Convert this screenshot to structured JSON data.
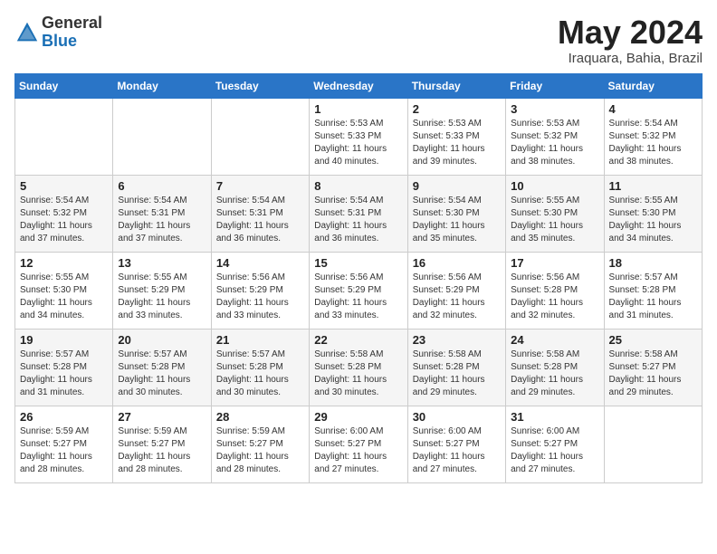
{
  "logo": {
    "general": "General",
    "blue": "Blue"
  },
  "title": "May 2024",
  "location": "Iraquara, Bahia, Brazil",
  "days_of_week": [
    "Sunday",
    "Monday",
    "Tuesday",
    "Wednesday",
    "Thursday",
    "Friday",
    "Saturday"
  ],
  "weeks": [
    [
      {
        "day": "",
        "info": ""
      },
      {
        "day": "",
        "info": ""
      },
      {
        "day": "",
        "info": ""
      },
      {
        "day": "1",
        "info": "Sunrise: 5:53 AM\nSunset: 5:33 PM\nDaylight: 11 hours\nand 40 minutes."
      },
      {
        "day": "2",
        "info": "Sunrise: 5:53 AM\nSunset: 5:33 PM\nDaylight: 11 hours\nand 39 minutes."
      },
      {
        "day": "3",
        "info": "Sunrise: 5:53 AM\nSunset: 5:32 PM\nDaylight: 11 hours\nand 38 minutes."
      },
      {
        "day": "4",
        "info": "Sunrise: 5:54 AM\nSunset: 5:32 PM\nDaylight: 11 hours\nand 38 minutes."
      }
    ],
    [
      {
        "day": "5",
        "info": "Sunrise: 5:54 AM\nSunset: 5:32 PM\nDaylight: 11 hours\nand 37 minutes."
      },
      {
        "day": "6",
        "info": "Sunrise: 5:54 AM\nSunset: 5:31 PM\nDaylight: 11 hours\nand 37 minutes."
      },
      {
        "day": "7",
        "info": "Sunrise: 5:54 AM\nSunset: 5:31 PM\nDaylight: 11 hours\nand 36 minutes."
      },
      {
        "day": "8",
        "info": "Sunrise: 5:54 AM\nSunset: 5:31 PM\nDaylight: 11 hours\nand 36 minutes."
      },
      {
        "day": "9",
        "info": "Sunrise: 5:54 AM\nSunset: 5:30 PM\nDaylight: 11 hours\nand 35 minutes."
      },
      {
        "day": "10",
        "info": "Sunrise: 5:55 AM\nSunset: 5:30 PM\nDaylight: 11 hours\nand 35 minutes."
      },
      {
        "day": "11",
        "info": "Sunrise: 5:55 AM\nSunset: 5:30 PM\nDaylight: 11 hours\nand 34 minutes."
      }
    ],
    [
      {
        "day": "12",
        "info": "Sunrise: 5:55 AM\nSunset: 5:30 PM\nDaylight: 11 hours\nand 34 minutes."
      },
      {
        "day": "13",
        "info": "Sunrise: 5:55 AM\nSunset: 5:29 PM\nDaylight: 11 hours\nand 33 minutes."
      },
      {
        "day": "14",
        "info": "Sunrise: 5:56 AM\nSunset: 5:29 PM\nDaylight: 11 hours\nand 33 minutes."
      },
      {
        "day": "15",
        "info": "Sunrise: 5:56 AM\nSunset: 5:29 PM\nDaylight: 11 hours\nand 33 minutes."
      },
      {
        "day": "16",
        "info": "Sunrise: 5:56 AM\nSunset: 5:29 PM\nDaylight: 11 hours\nand 32 minutes."
      },
      {
        "day": "17",
        "info": "Sunrise: 5:56 AM\nSunset: 5:28 PM\nDaylight: 11 hours\nand 32 minutes."
      },
      {
        "day": "18",
        "info": "Sunrise: 5:57 AM\nSunset: 5:28 PM\nDaylight: 11 hours\nand 31 minutes."
      }
    ],
    [
      {
        "day": "19",
        "info": "Sunrise: 5:57 AM\nSunset: 5:28 PM\nDaylight: 11 hours\nand 31 minutes."
      },
      {
        "day": "20",
        "info": "Sunrise: 5:57 AM\nSunset: 5:28 PM\nDaylight: 11 hours\nand 30 minutes."
      },
      {
        "day": "21",
        "info": "Sunrise: 5:57 AM\nSunset: 5:28 PM\nDaylight: 11 hours\nand 30 minutes."
      },
      {
        "day": "22",
        "info": "Sunrise: 5:58 AM\nSunset: 5:28 PM\nDaylight: 11 hours\nand 30 minutes."
      },
      {
        "day": "23",
        "info": "Sunrise: 5:58 AM\nSunset: 5:28 PM\nDaylight: 11 hours\nand 29 minutes."
      },
      {
        "day": "24",
        "info": "Sunrise: 5:58 AM\nSunset: 5:28 PM\nDaylight: 11 hours\nand 29 minutes."
      },
      {
        "day": "25",
        "info": "Sunrise: 5:58 AM\nSunset: 5:27 PM\nDaylight: 11 hours\nand 29 minutes."
      }
    ],
    [
      {
        "day": "26",
        "info": "Sunrise: 5:59 AM\nSunset: 5:27 PM\nDaylight: 11 hours\nand 28 minutes."
      },
      {
        "day": "27",
        "info": "Sunrise: 5:59 AM\nSunset: 5:27 PM\nDaylight: 11 hours\nand 28 minutes."
      },
      {
        "day": "28",
        "info": "Sunrise: 5:59 AM\nSunset: 5:27 PM\nDaylight: 11 hours\nand 28 minutes."
      },
      {
        "day": "29",
        "info": "Sunrise: 6:00 AM\nSunset: 5:27 PM\nDaylight: 11 hours\nand 27 minutes."
      },
      {
        "day": "30",
        "info": "Sunrise: 6:00 AM\nSunset: 5:27 PM\nDaylight: 11 hours\nand 27 minutes."
      },
      {
        "day": "31",
        "info": "Sunrise: 6:00 AM\nSunset: 5:27 PM\nDaylight: 11 hours\nand 27 minutes."
      },
      {
        "day": "",
        "info": ""
      }
    ]
  ]
}
